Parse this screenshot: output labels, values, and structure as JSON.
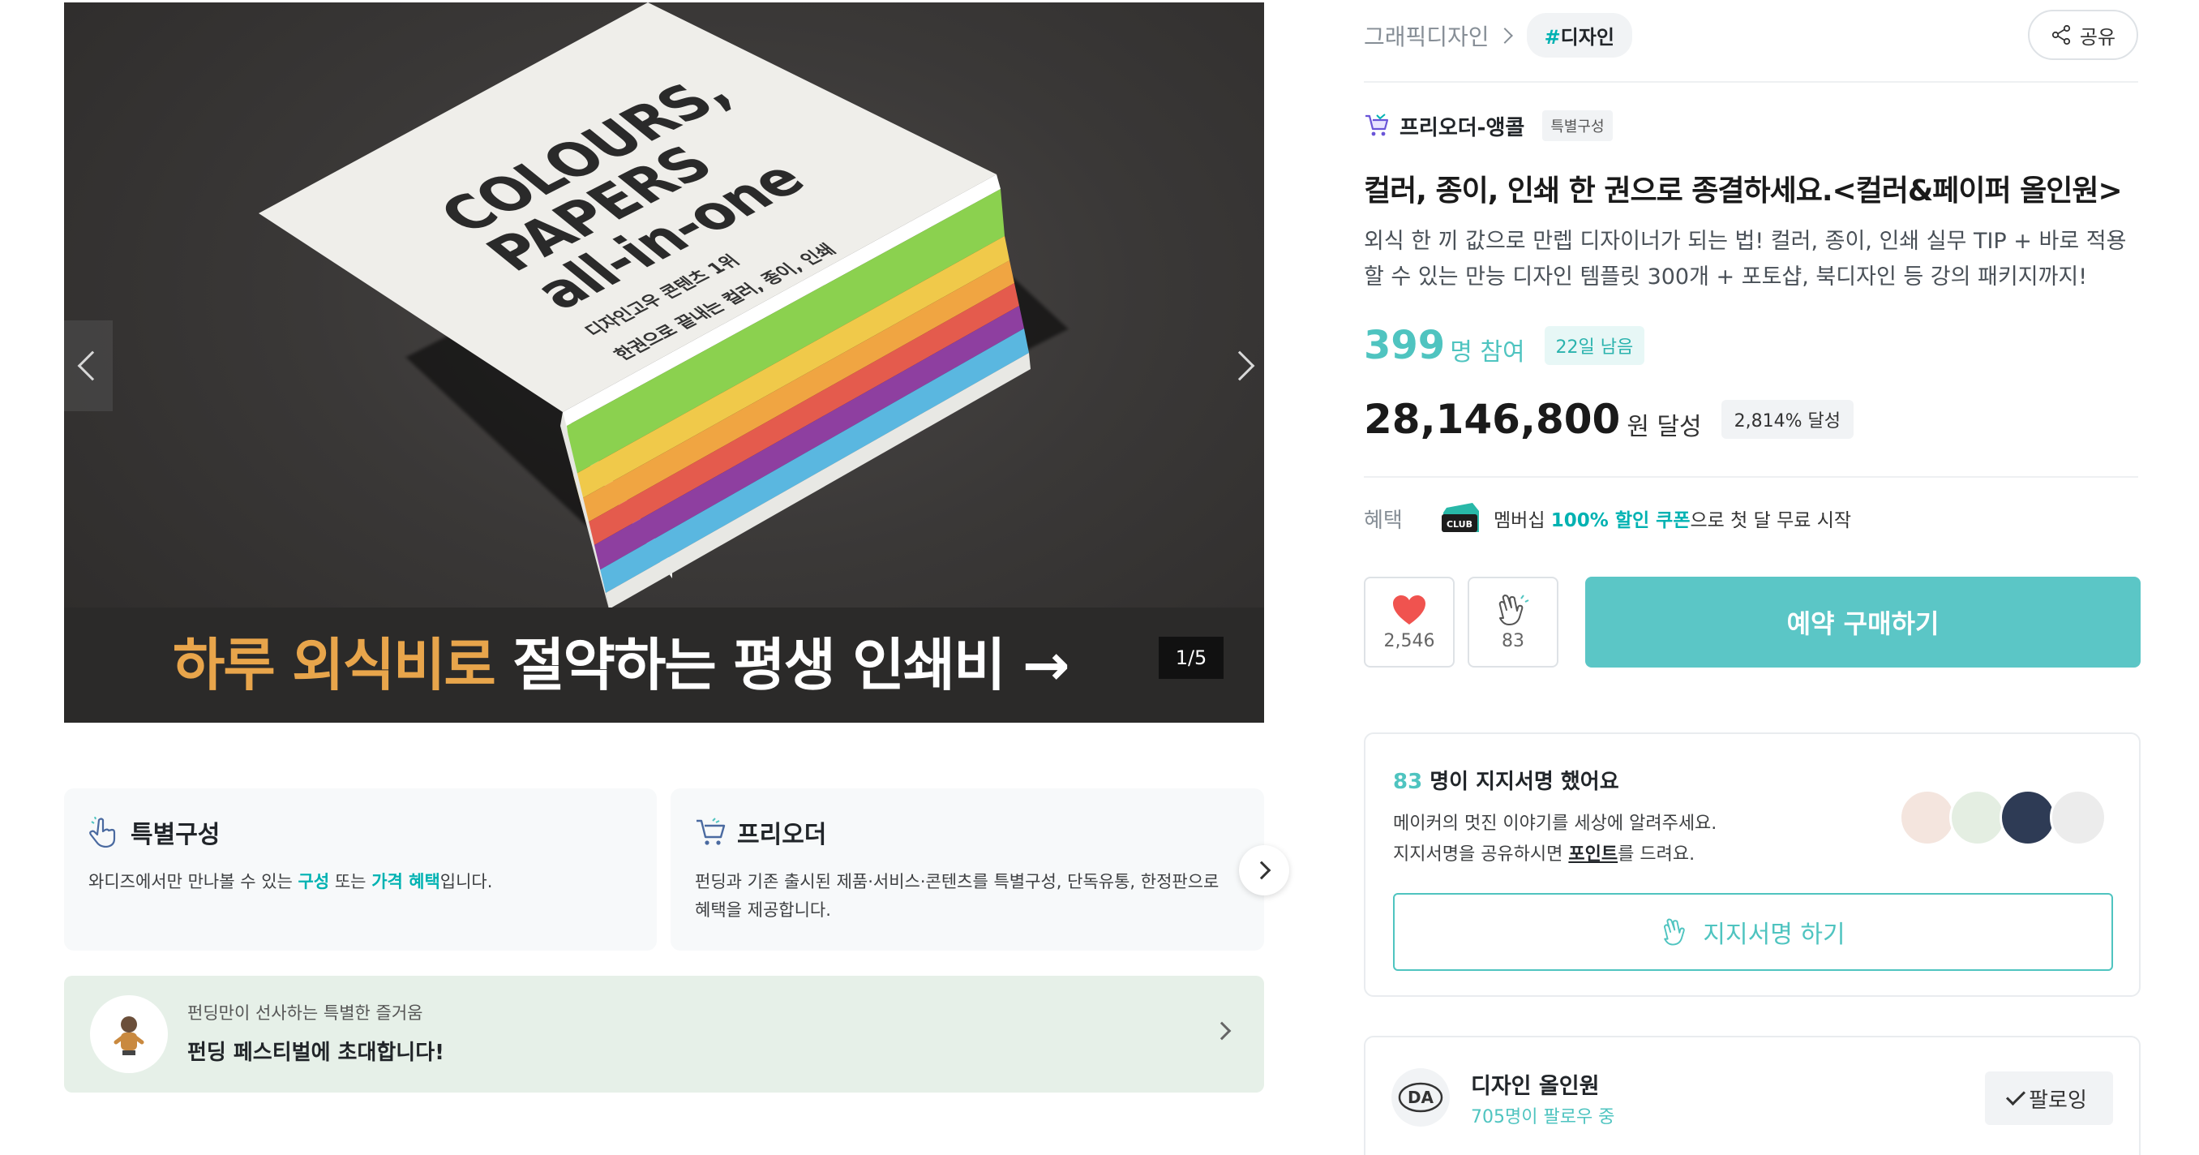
{
  "hero": {
    "book_title": [
      "COLOURS,",
      "PAPERS",
      "all-in-one"
    ],
    "book_subtitle": [
      "디자인고우 콘텐츠 1위",
      "한권으로 끝내는 컬러, 종이, 인쇄"
    ],
    "caption_highlight": "하루 외식비로",
    "caption_rest": " 절약하는 평생 인쇄비 →",
    "counter": "1/5"
  },
  "cards": [
    {
      "title": "특별구성",
      "text_a": "와디즈에서만 만나볼 수 있는 ",
      "accent_a": "구성",
      "text_b": " 또는 ",
      "accent_b": "가격 혜택",
      "text_c": "입니다."
    },
    {
      "title": "프리오더",
      "text": "펀딩과 기존 출시된 제품·서비스·콘텐츠를 특별구성, 단독유통, 한정판으로 혜택을 제공합니다."
    }
  ],
  "festival": {
    "subtitle": "펀딩만이 선사하는 특별한 즐거움",
    "title": "펀딩 페스티벌에 초대합니다!"
  },
  "breadcrumb": {
    "category": "그래픽디자인",
    "tag_hash": "#",
    "tag": "디자인"
  },
  "share_label": "공유",
  "maker": {
    "name": "프리오더-앵콜",
    "badge": "특별구성"
  },
  "title": "컬러, 종이, 인쇄 한 권으로 종결하세요.<컬러&페이퍼 올인원>",
  "description": "외식 한 끼 값으로 만렙 디자이너가 되는 법! 컬러, 종이, 인쇄 실무 TIP + 바로 적용할 수 있는 만능 디자인 템플릿 300개 + 포토샵, 북디자인 등 강의 패키지까지!",
  "stats": {
    "participants": "399",
    "participants_unit": "명 참여",
    "days_left": "22일 남음",
    "amount": "28,146,800",
    "amount_unit": "원 달성",
    "achieved": "2,814% 달성"
  },
  "benefit": {
    "label": "혜택",
    "club_text": "CLUB",
    "text_a": "멤버십 ",
    "accent": "100% 할인 쿠폰",
    "text_b": "으로 첫 달 무료 시작"
  },
  "actions": {
    "like_count": "2,546",
    "cheer_count": "83",
    "buy_label": "예약 구매하기"
  },
  "support": {
    "count": "83",
    "title_rest": " 명이 지지서명 했어요",
    "line1": "메이커의 멋진 이야기를 세상에 알려주세요.",
    "line2_a": "지지서명을 공유하시면 ",
    "line2_strong": "포인트",
    "line2_b": "를 드려요.",
    "button": "지지서명 하기"
  },
  "creator": {
    "logo_text": "DA",
    "name": "디자인 올인원",
    "followers": "705명이 팔로우 중",
    "follow_button": "팔로잉"
  },
  "colors": {
    "mint": "#4fc4c0",
    "buy_button": "#5bc6c6",
    "accent": "#00b2b2",
    "caption_highlight": "#e8a54b"
  }
}
